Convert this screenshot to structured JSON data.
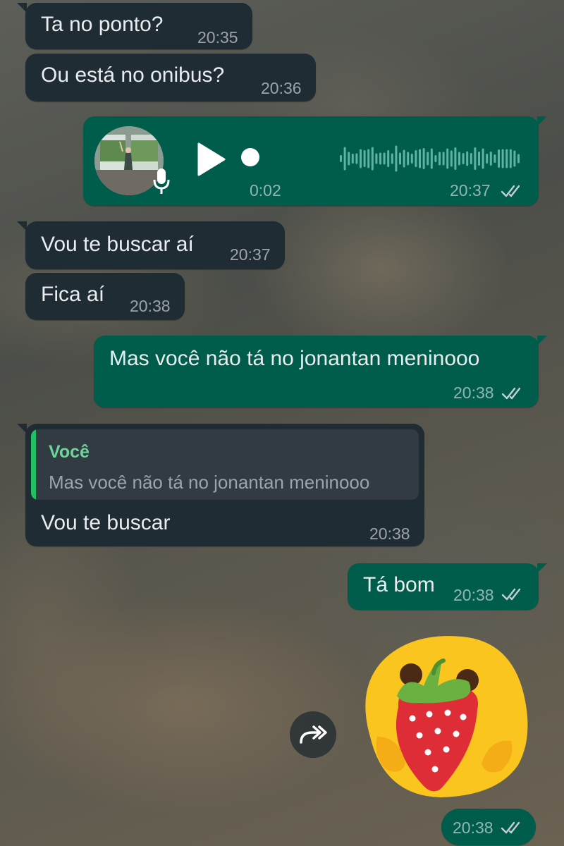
{
  "messages": [
    {
      "text": "Ta no ponto?",
      "time": "20:35"
    },
    {
      "text": "Ou está no onibus?",
      "time": "20:36"
    },
    {
      "voice_duration": "0:02",
      "time": "20:37",
      "status": "read"
    },
    {
      "text": "Vou te buscar aí",
      "time": "20:37"
    },
    {
      "text": "Fica aí",
      "time": "20:38"
    },
    {
      "text": "Mas você não tá no jonantan meninooo",
      "time": "20:38",
      "status": "read"
    },
    {
      "quote_author": "Você",
      "quote_text": "Mas você não tá no jonantan meninooo",
      "text": "Vou te buscar",
      "time": "20:38"
    },
    {
      "text": "Tá bom",
      "time": "20:38",
      "status": "read"
    },
    {
      "sticker": "strawberry-blob-sticker",
      "time": "20:38",
      "status": "read"
    }
  ],
  "colors": {
    "incoming_bubble": "#1f2c33",
    "outgoing_bubble": "#005c4b",
    "read_ticks": "#c3cfd2",
    "quote_accent": "#21c063"
  },
  "icons": {
    "play": "play-icon",
    "mic": "mic-icon",
    "forward": "forward-icon",
    "read": "double-check-icon"
  }
}
